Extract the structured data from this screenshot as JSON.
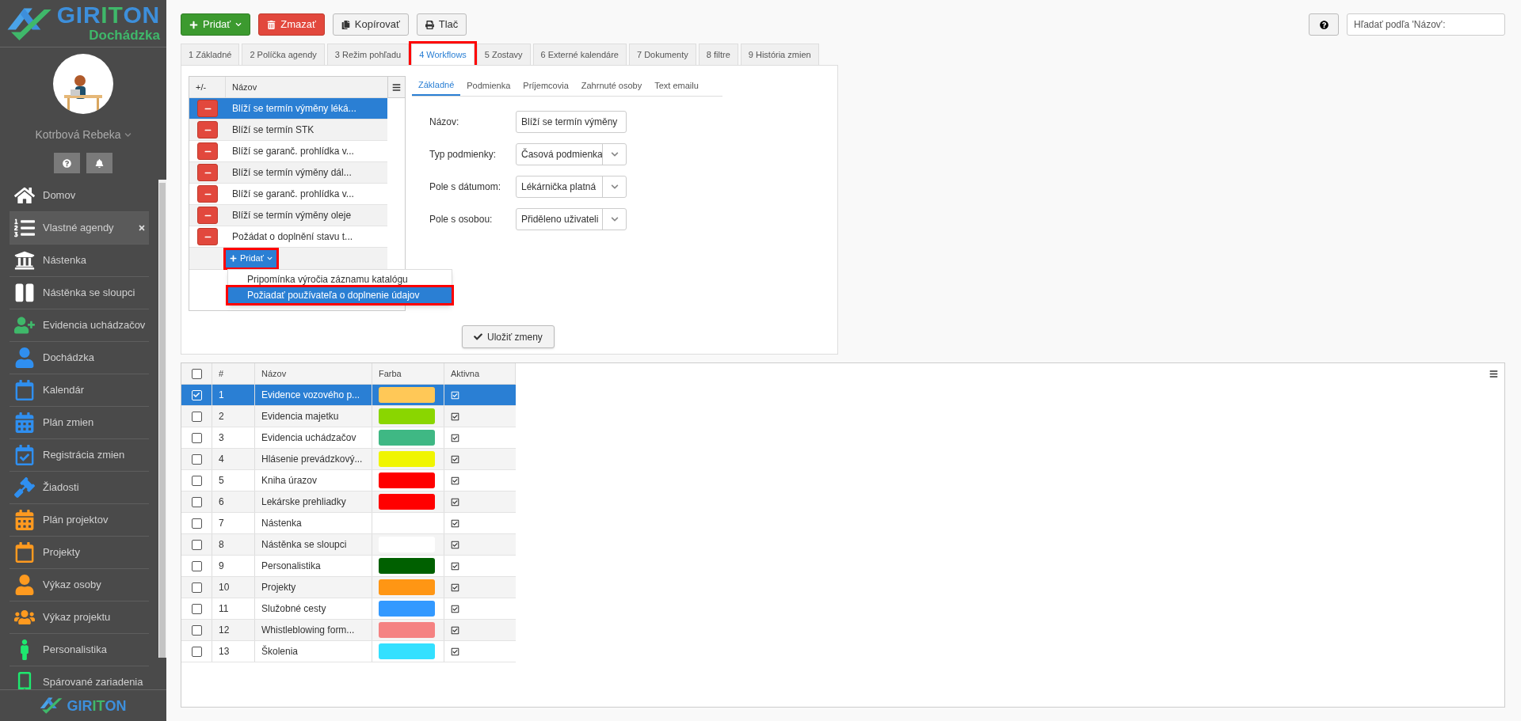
{
  "logo": {
    "parts": [
      {
        "text": "GIR",
        "color": "#3d8fdb"
      },
      {
        "text": "IT",
        "color": "#3fb86a"
      },
      {
        "text": "ON",
        "color": "#3d8fdb"
      }
    ],
    "subtitle": "Dochádzka"
  },
  "user": {
    "name": "Kotrbová Rebeka"
  },
  "sidebar": {
    "items": [
      {
        "label": "Domov",
        "color": "#ffffff",
        "selected": false
      },
      {
        "label": "Vlastné agendy",
        "color": "#ffffff",
        "selected": true
      },
      {
        "label": "Nástenka",
        "color": "#ffffff",
        "selected": false
      },
      {
        "label": "Nástěnka se sloupci",
        "color": "#ffffff",
        "selected": false
      },
      {
        "label": "Evidencia uchádzačov",
        "color": "#3fb86a",
        "selected": false
      },
      {
        "label": "Dochádzka",
        "color": "#2f8ff0",
        "selected": false
      },
      {
        "label": "Kalendár",
        "color": "#2f8ff0",
        "selected": false
      },
      {
        "label": "Plán zmien",
        "color": "#2f8ff0",
        "selected": false
      },
      {
        "label": "Registrácia zmien",
        "color": "#2f8ff0",
        "selected": false
      },
      {
        "label": "Žiadosti",
        "color": "#2f8ff0",
        "selected": false
      },
      {
        "label": "Plán projektov",
        "color": "#ff9a1f",
        "selected": false
      },
      {
        "label": "Projekty",
        "color": "#ff9a1f",
        "selected": false
      },
      {
        "label": "Výkaz osoby",
        "color": "#ff9a1f",
        "selected": false
      },
      {
        "label": "Výkaz projektu",
        "color": "#ff9a1f",
        "selected": false
      },
      {
        "label": "Personalistika",
        "color": "#1ee86f",
        "selected": false
      },
      {
        "label": "Spárované zariadenia",
        "color": "#1ee86f",
        "selected": false
      }
    ]
  },
  "footer_logo": {
    "parts": [
      {
        "text": "GIR",
        "color": "#3d8fdb"
      },
      {
        "text": "IT",
        "color": "#3fb86a"
      },
      {
        "text": "ON",
        "color": "#3d8fdb"
      }
    ]
  },
  "toolbar": {
    "buttons": [
      {
        "kind": "add",
        "label": "Pridať"
      },
      {
        "kind": "delete",
        "label": "Zmazať"
      },
      {
        "kind": "copy",
        "label": "Kopírovať"
      },
      {
        "kind": "print",
        "label": "Tlač"
      }
    ]
  },
  "search": {
    "placeholder": "Hľadať podľa 'Názov':"
  },
  "tabs": [
    {
      "label": "1 Základné",
      "selected": false,
      "highlighted": false
    },
    {
      "label": "2 Políčka agendy",
      "selected": false,
      "highlighted": false
    },
    {
      "label": "3 Režim pohľadu",
      "selected": false,
      "highlighted": false
    },
    {
      "label": "4 Workflows",
      "selected": true,
      "highlighted": true
    },
    {
      "label": "5 Zostavy",
      "selected": false,
      "highlighted": false
    },
    {
      "label": "6 Externé kalendáre",
      "selected": false,
      "highlighted": false
    },
    {
      "label": "7 Dokumenty",
      "selected": false,
      "highlighted": false
    },
    {
      "label": "8 filtre",
      "selected": false,
      "highlighted": false
    },
    {
      "label": "9 História zmien",
      "selected": false,
      "highlighted": false
    }
  ],
  "workflows": {
    "columns": [
      "+/-",
      "Názov"
    ],
    "rows": [
      {
        "name": "Blíží se termín výměny léká...",
        "selected": true
      },
      {
        "name": "Blíží se termín STK",
        "selected": false
      },
      {
        "name": "Blíží se garanč. prohlídka v...",
        "selected": false
      },
      {
        "name": "Blíží se termín výměny dál...",
        "selected": false
      },
      {
        "name": "Blíží se garanč. prohlídka v...",
        "selected": false
      },
      {
        "name": "Blíží se termín výměny oleje",
        "selected": false
      },
      {
        "name": "Požádat o doplnění stavu t...",
        "selected": false
      }
    ],
    "add_button": {
      "label": "Pridať",
      "highlighted": true
    },
    "add_menu": [
      {
        "label": "Pripomínka výročia záznamu katalógu",
        "selected": false,
        "highlighted": false
      },
      {
        "label": "Požiadať používateľa o doplnenie údajov",
        "selected": true,
        "highlighted": true
      }
    ]
  },
  "detail": {
    "tabs": [
      {
        "label": "Základné",
        "selected": true
      },
      {
        "label": "Podmienka",
        "selected": false
      },
      {
        "label": "Príjemcovia",
        "selected": false
      },
      {
        "label": "Zahrnuté osoby",
        "selected": false
      },
      {
        "label": "Text emailu",
        "selected": false
      }
    ],
    "fields": [
      {
        "kind": "text",
        "label": "Názov:",
        "value": "Blíží se termín výměny"
      },
      {
        "kind": "select",
        "label": "Typ podmienky:",
        "value": "Časová podmienka"
      },
      {
        "kind": "select",
        "label": "Pole s dátumom:",
        "value": "Lékárnička platná"
      },
      {
        "kind": "select",
        "label": "Pole s osobou:",
        "value": "Přiděleno uživateli"
      }
    ],
    "save_button": "Uložiť zmeny"
  },
  "table": {
    "header_checked": false,
    "columns": [
      "#",
      "Názov",
      "Farba",
      "Aktivna"
    ],
    "rows": [
      {
        "number": "1",
        "name": "Evidence vozového p...",
        "color": "#ffc857",
        "active": true,
        "selected": true
      },
      {
        "number": "2",
        "name": "Evidencia majetku",
        "color": "#8ad600",
        "active": true,
        "selected": false
      },
      {
        "number": "3",
        "name": "Evidencia uchádzačov",
        "color": "#3fb884",
        "active": true,
        "selected": false
      },
      {
        "number": "4",
        "name": "Hlásenie prevádzkový...",
        "color": "#f0f500",
        "active": true,
        "selected": false
      },
      {
        "number": "5",
        "name": "Kniha úrazov",
        "color": "#ff0000",
        "active": true,
        "selected": false
      },
      {
        "number": "6",
        "name": "Lekárske prehliadky",
        "color": "#ff0000",
        "active": true,
        "selected": false
      },
      {
        "number": "7",
        "name": "Nástenka",
        "active": true,
        "selected": false
      },
      {
        "number": "8",
        "name": "Nástěnka se sloupci",
        "color": "#ffffff",
        "active": true,
        "selected": false
      },
      {
        "number": "9",
        "name": "Personalistika",
        "color": "#006000",
        "active": true,
        "selected": false
      },
      {
        "number": "10",
        "name": "Projekty",
        "color": "#ff9614",
        "active": true,
        "selected": false
      },
      {
        "number": "11",
        "name": "Služobné cesty",
        "color": "#3399ff",
        "active": true,
        "selected": false
      },
      {
        "number": "12",
        "name": "Whistleblowing form...",
        "color": "#f58282",
        "active": true,
        "selected": false
      },
      {
        "number": "13",
        "name": "Školenia",
        "color": "#33e0ff",
        "active": true,
        "selected": false
      }
    ]
  }
}
